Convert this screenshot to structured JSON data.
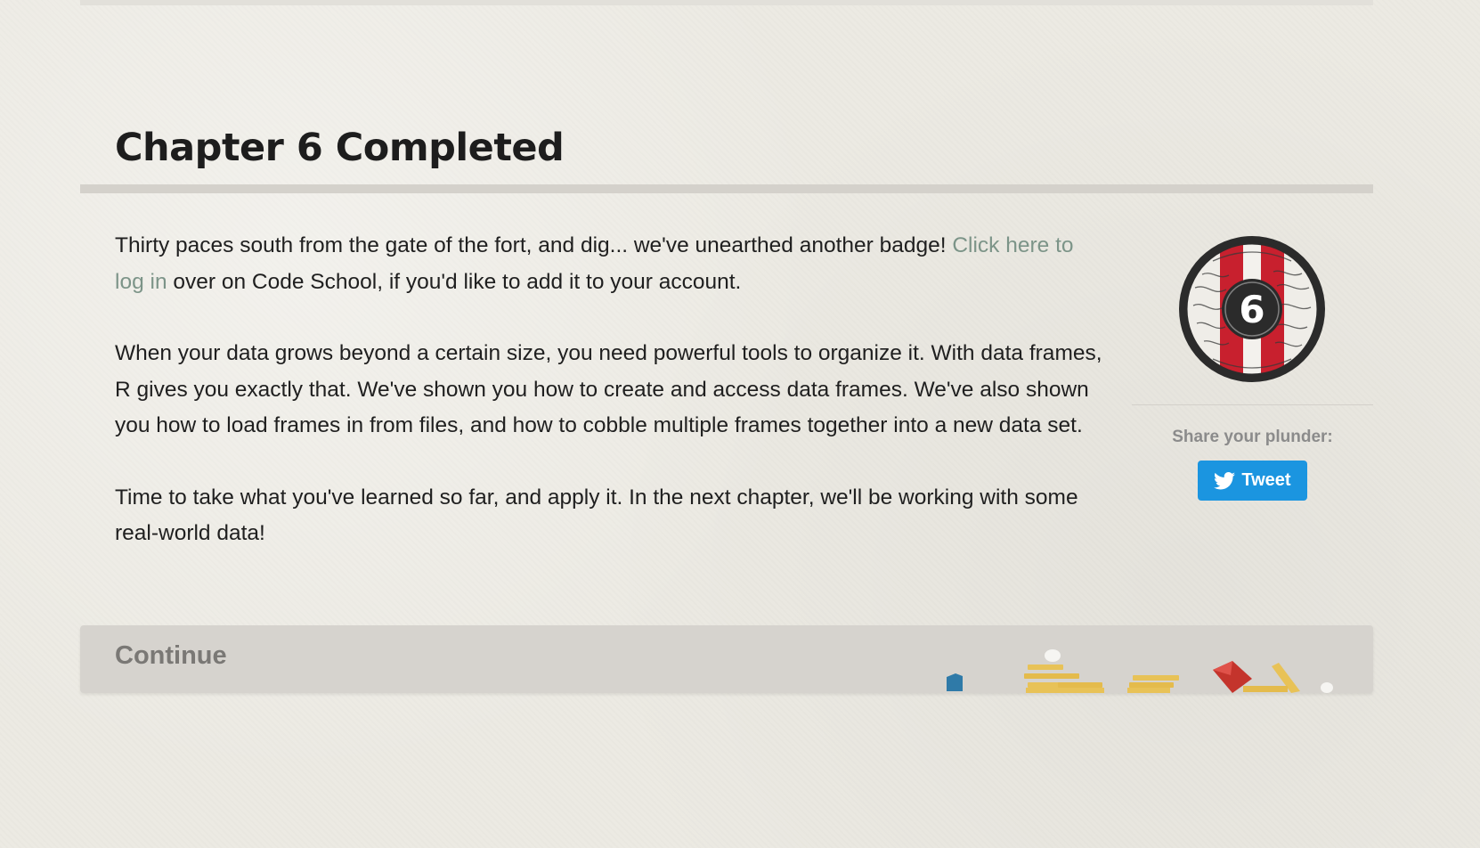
{
  "page": {
    "title": "Chapter 6 Completed"
  },
  "content": {
    "p1_before_link": "Thirty paces south from the gate of the fort, and dig... we've unearthed another badge! ",
    "p1_link": "Click here to log in",
    "p1_after_link": " over on Code School, if you'd like to add it to your account.",
    "p2": "When your data grows beyond a certain size, you need powerful tools to organize it. With data frames, R gives you exactly that. We've shown you how to create and access data frames. We've also shown you how to load frames in from files, and how to cobble multiple frames together into a new data set.",
    "p3": "Time to take what you've learned so far, and apply it. In the next chapter, we'll be working with some real-world data!"
  },
  "badge": {
    "number": "6",
    "icon": "chapter-badge-icon"
  },
  "share": {
    "label": "Share your plunder:",
    "tweet_label": "Tweet",
    "icon": "twitter-bird-icon"
  },
  "continue": {
    "label": "Continue"
  },
  "colors": {
    "background": "#eceae3",
    "link": "#7c9488",
    "tweet_button": "#1b95e0",
    "badge_red": "#c8202e",
    "continue_bar": "#d6d3ce"
  }
}
